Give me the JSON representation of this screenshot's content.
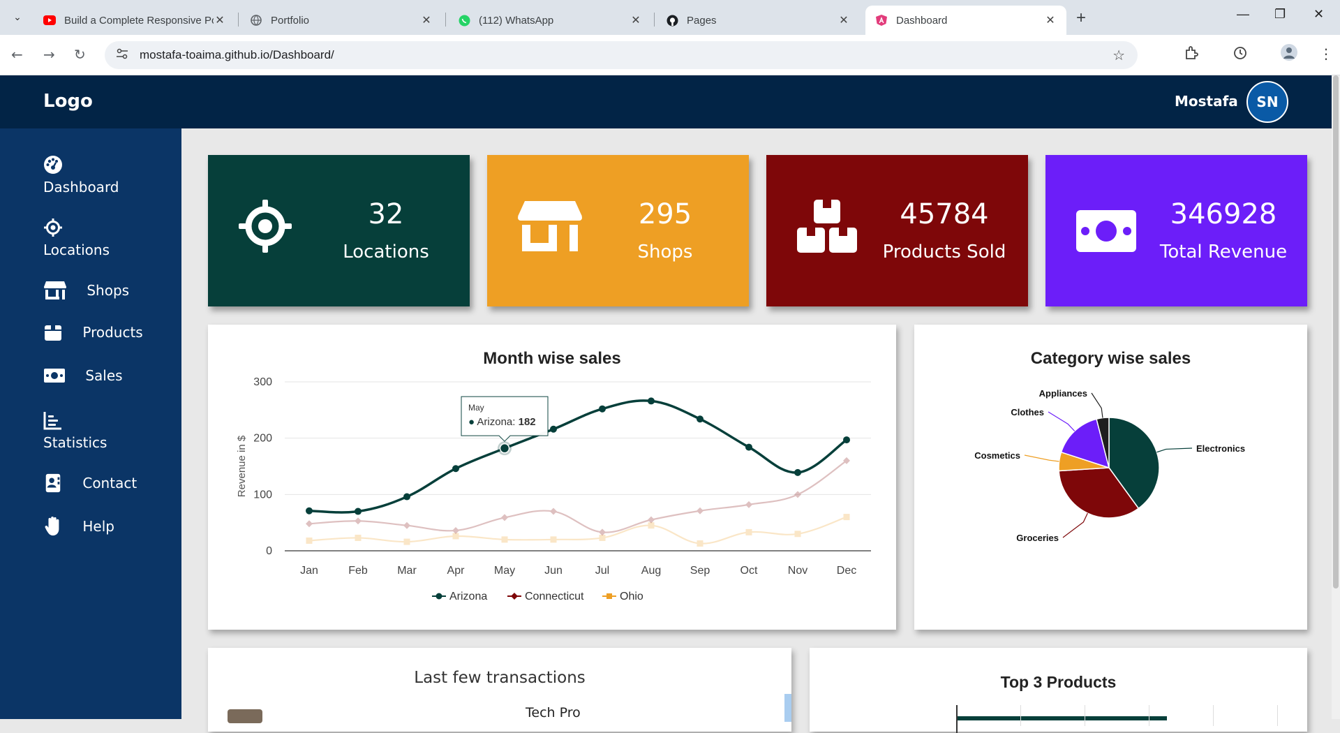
{
  "browser": {
    "tabs": [
      {
        "title": "Build a Complete Responsive Po",
        "icon": "youtube-icon"
      },
      {
        "title": "Portfolio",
        "icon": "globe-icon"
      },
      {
        "title": "(112) WhatsApp",
        "icon": "whatsapp-icon"
      },
      {
        "title": "Pages",
        "icon": "github-icon"
      },
      {
        "title": "Dashboard",
        "icon": "angular-icon"
      }
    ],
    "url": "mostafa-toaima.github.io/Dashboard/"
  },
  "header": {
    "logo": "Logo",
    "username": "Mostafa",
    "avatar_initials": "SN"
  },
  "sidebar": {
    "items": [
      {
        "label": "Dashboard",
        "icon": "dashboard-icon"
      },
      {
        "label": "Locations",
        "icon": "crosshair-icon"
      },
      {
        "label": "Shops",
        "icon": "store-icon"
      },
      {
        "label": "Products",
        "icon": "box-icon"
      },
      {
        "label": "Sales",
        "icon": "money-icon"
      },
      {
        "label": "Statistics",
        "icon": "chart-icon"
      },
      {
        "label": "Contact",
        "icon": "contact-icon"
      },
      {
        "label": "Help",
        "icon": "hand-icon"
      }
    ]
  },
  "stats": [
    {
      "value": "32",
      "label": "Locations",
      "color": "#063f3a",
      "icon": "crosshair-icon"
    },
    {
      "value": "295",
      "label": "Shops",
      "color": "#ee9f24",
      "icon": "store-icon"
    },
    {
      "value": "45784",
      "label": "Products Sold",
      "color": "#7e0709",
      "icon": "boxes-icon"
    },
    {
      "value": "346928",
      "label": "Total Revenue",
      "color": "#6c1ef9",
      "icon": "money-icon"
    }
  ],
  "panels": {
    "transactions_title": "Last few transactions",
    "transactions_first_item": "Tech Pro",
    "top_products_title": "Top 3 Products"
  },
  "chart_data": [
    {
      "type": "line",
      "title": "Month wise sales",
      "ylabel": "Revenue in $",
      "xlabel": "",
      "categories": [
        "Jan",
        "Feb",
        "Mar",
        "Apr",
        "May",
        "Jun",
        "Jul",
        "Aug",
        "Sep",
        "Oct",
        "Nov",
        "Dec"
      ],
      "ylim": [
        0,
        300
      ],
      "yticks": [
        0,
        100,
        200,
        300
      ],
      "grid": true,
      "legend_position": "bottom",
      "series": [
        {
          "name": "Arizona",
          "color": "#063f3a",
          "values": [
            71,
            70,
            96,
            146,
            182,
            216,
            252,
            266,
            234,
            184,
            139,
            197
          ]
        },
        {
          "name": "Connecticut",
          "color": "#7e0709",
          "values": [
            48,
            53,
            45,
            36,
            59,
            70,
            33,
            55,
            71,
            82,
            100,
            160
          ]
        },
        {
          "name": "Ohio",
          "color": "#ee9f24",
          "values": [
            18,
            23,
            16,
            26,
            20,
            20,
            23,
            45,
            13,
            33,
            30,
            60
          ]
        }
      ],
      "tooltip": {
        "category": "May",
        "series": "Arizona",
        "value": "182"
      }
    },
    {
      "type": "pie",
      "title": "Category wise sales",
      "legend_position": "labels",
      "slices": [
        {
          "name": "Electronics",
          "value": 40,
          "color": "#063f3a"
        },
        {
          "name": "Groceries",
          "value": 34,
          "color": "#7e0709"
        },
        {
          "name": "Cosmetics",
          "value": 6,
          "color": "#ee9f24"
        },
        {
          "name": "Clothes",
          "value": 16,
          "color": "#6c1ef9"
        },
        {
          "name": "Appliances",
          "value": 4,
          "color": "#1e1e1e"
        }
      ]
    }
  ]
}
